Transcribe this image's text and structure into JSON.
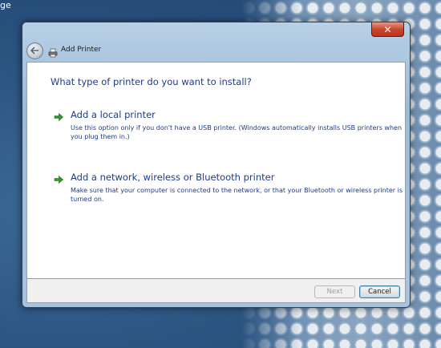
{
  "desktop": {
    "corner_text": "ge"
  },
  "window": {
    "title": "Add Printer",
    "close_label": "✕"
  },
  "content": {
    "heading": "What type of printer do you want to install?",
    "options": [
      {
        "title": "Add a local printer",
        "description": "Use this option only if you don't have a USB printer. (Windows automatically installs USB printers when you plug them in.)"
      },
      {
        "title": "Add a network, wireless or Bluetooth printer",
        "description": "Make sure that your computer is connected to the network, or that your Bluetooth or wireless printer is turned on."
      }
    ]
  },
  "footer": {
    "next_label": "Next",
    "cancel_label": "Cancel"
  },
  "colors": {
    "link_text": "#1e3b8a",
    "arrow_green": "#2f9b2f",
    "close_red": "#c9462f"
  },
  "icons": {
    "back": "back-arrow-icon",
    "title": "printer-icon",
    "option_arrow": "green-arrow-icon"
  }
}
